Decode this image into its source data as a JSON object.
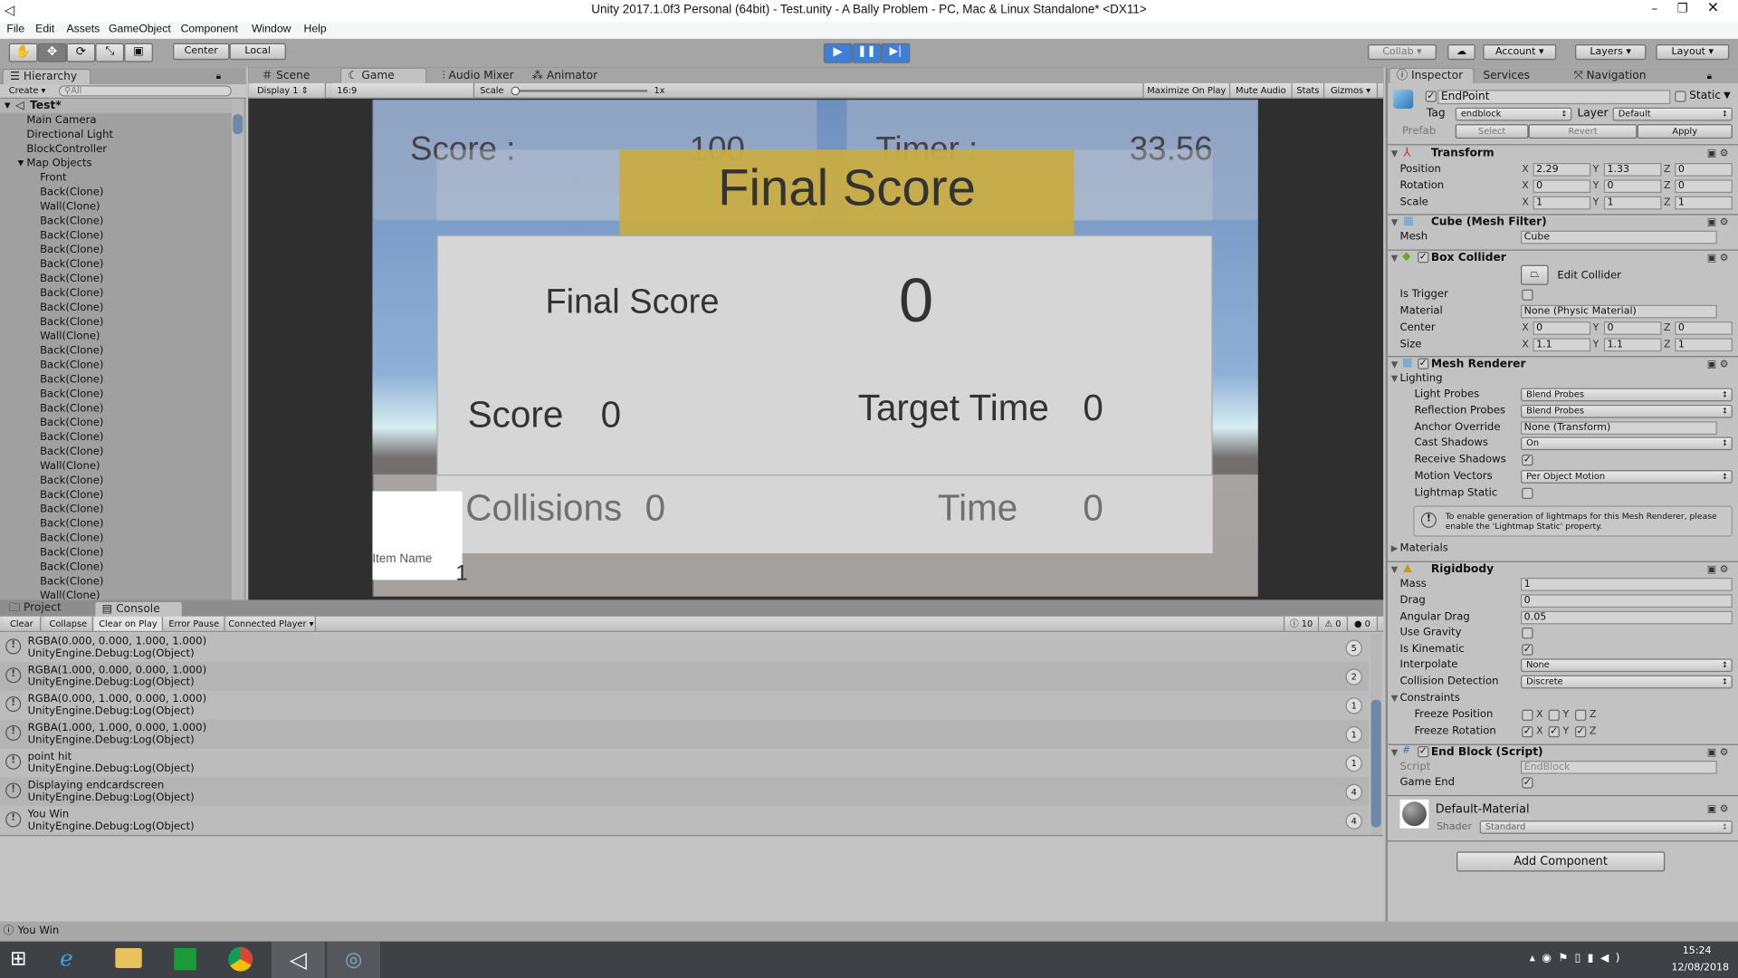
{
  "window": {
    "title": "Unity 2017.1.0f3 Personal (64bit) - Test.unity - A Bally Problem - PC, Mac & Linux Standalone* <DX11>"
  },
  "menu": [
    "File",
    "Edit",
    "Assets",
    "GameObject",
    "Component",
    "Window",
    "Help"
  ],
  "toolbar": {
    "pivot": "Center",
    "space": "Local",
    "collab": "Collab",
    "account": "Account",
    "layers": "Layers",
    "layout": "Layout"
  },
  "hierarchy": {
    "tab": "Hierarchy",
    "create": "Create",
    "search_placeholder": "All",
    "scene": "Test*",
    "top_items": [
      "Main Camera",
      "Directional Light",
      "BlockController",
      "Map Objects"
    ],
    "children": [
      "Front",
      "Back(Clone)",
      "Wall(Clone)",
      "Back(Clone)",
      "Back(Clone)",
      "Back(Clone)",
      "Back(Clone)",
      "Back(Clone)",
      "Back(Clone)",
      "Back(Clone)",
      "Back(Clone)",
      "Wall(Clone)",
      "Back(Clone)",
      "Back(Clone)",
      "Back(Clone)",
      "Back(Clone)",
      "Back(Clone)",
      "Back(Clone)",
      "Back(Clone)",
      "Back(Clone)",
      "Wall(Clone)",
      "Back(Clone)",
      "Back(Clone)",
      "Back(Clone)",
      "Back(Clone)",
      "Back(Clone)",
      "Back(Clone)",
      "Back(Clone)",
      "Back(Clone)",
      "Wall(Clone)"
    ]
  },
  "view_tabs": [
    "Scene",
    "Game",
    "Audio Mixer",
    "Animator"
  ],
  "game_toolbar": {
    "display": "Display 1",
    "aspect": "16:9",
    "scale_label": "Scale",
    "scale_value": "1x",
    "maximize": "Maximize On Play",
    "mute": "Mute Audio",
    "stats": "Stats",
    "gizmos": "Gizmos"
  },
  "game": {
    "score_label": "Score :",
    "score_value": "100",
    "timer_label": "Timer :",
    "timer_value": "33.56",
    "banner": "Final Score",
    "final_score_label": "Final Score",
    "final_score_value": "0",
    "score2_label": "Score",
    "score2_value": "0",
    "target_time_label": "Target Time",
    "target_time_value": "0",
    "collisions_label": "Collisions",
    "collisions_value": "0",
    "time_label": "Time",
    "time_value": "0",
    "item_name": "Item Name",
    "item_count": "1",
    "banner_color": "#c9ab3f"
  },
  "console": {
    "tabs": [
      "Project",
      "Console"
    ],
    "buttons": [
      "Clear",
      "Collapse",
      "Clear on Play",
      "Error Pause",
      "Connected Player"
    ],
    "counts": {
      "log": "10",
      "warn": "0",
      "error": "0"
    },
    "entries": [
      {
        "msg": "RGBA(0.000, 0.000, 1.000, 1.000)",
        "trace": "UnityEngine.Debug:Log(Object)",
        "count": "5"
      },
      {
        "msg": "RGBA(1.000, 0.000, 0.000, 1.000)",
        "trace": "UnityEngine.Debug:Log(Object)",
        "count": "2"
      },
      {
        "msg": "RGBA(0.000, 1.000, 0.000, 1.000)",
        "trace": "UnityEngine.Debug:Log(Object)",
        "count": "1"
      },
      {
        "msg": "RGBA(1.000, 1.000, 0.000, 1.000)",
        "trace": "UnityEngine.Debug:Log(Object)",
        "count": "1"
      },
      {
        "msg": "point hit",
        "trace": "UnityEngine.Debug:Log(Object)",
        "count": "1"
      },
      {
        "msg": "Displaying endcardscreen",
        "trace": "UnityEngine.Debug:Log(Object)",
        "count": "4"
      },
      {
        "msg": "You Win",
        "trace": "UnityEngine.Debug:Log(Object)",
        "count": "4"
      }
    ]
  },
  "status": "You Win",
  "inspector": {
    "tabs": [
      "Inspector",
      "Services",
      "Navigation"
    ],
    "name": "EndPoint",
    "static": "Static",
    "tag_label": "Tag",
    "tag": "endblock",
    "layer_label": "Layer",
    "layer": "Default",
    "prefab": "Prefab",
    "select": "Select",
    "revert": "Revert",
    "apply": "Apply",
    "transform": {
      "title": "Transform",
      "position": [
        "2.29",
        "1.33",
        "0"
      ],
      "rotation": [
        "0",
        "0",
        "0"
      ],
      "scale": [
        "1",
        "1",
        "1"
      ],
      "labels": [
        "Position",
        "Rotation",
        "Scale"
      ]
    },
    "mesh_filter": {
      "title": "Cube (Mesh Filter)",
      "mesh_label": "Mesh",
      "mesh": "Cube"
    },
    "box_collider": {
      "title": "Box Collider",
      "edit": "Edit Collider",
      "is_trigger": "Is Trigger",
      "material_label": "Material",
      "material": "None (Physic Material)",
      "center_label": "Center",
      "center": [
        "0",
        "0",
        "0"
      ],
      "size_label": "Size",
      "size": [
        "1.1",
        "1.1",
        "1"
      ]
    },
    "mesh_renderer": {
      "title": "Mesh Renderer",
      "lighting": "Lighting",
      "light_probes_label": "Light Probes",
      "light_probes": "Blend Probes",
      "reflection_label": "Reflection Probes",
      "reflection": "Blend Probes",
      "anchor_label": "Anchor Override",
      "anchor": "None (Transform)",
      "cast_label": "Cast Shadows",
      "cast": "On",
      "receive_label": "Receive Shadows",
      "motion_label": "Motion Vectors",
      "motion": "Per Object Motion",
      "lightmap_label": "Lightmap Static",
      "help": "To enable generation of lightmaps for this Mesh Renderer, please enable the 'Lightmap Static' property.",
      "materials": "Materials"
    },
    "rigidbody": {
      "title": "Rigidbody",
      "mass_label": "Mass",
      "mass": "1",
      "drag_label": "Drag",
      "drag": "0",
      "angular_label": "Angular Drag",
      "angular": "0.05",
      "gravity_label": "Use Gravity",
      "kinematic_label": "Is Kinematic",
      "interpolate_label": "Interpolate",
      "interpolate": "None",
      "collision_label": "Collision Detection",
      "collision": "Discrete",
      "constraints": "Constraints",
      "freeze_pos": "Freeze Position",
      "freeze_rot": "Freeze Rotation"
    },
    "end_block": {
      "title": "End Block (Script)",
      "script_label": "Script",
      "script": "EndBlock",
      "game_end_label": "Game End"
    },
    "material": {
      "name": "Default-Material",
      "shader_label": "Shader",
      "shader": "Standard"
    },
    "add_component": "Add Component"
  },
  "taskbar": {
    "time": "15:24",
    "date": "12/08/2018"
  }
}
